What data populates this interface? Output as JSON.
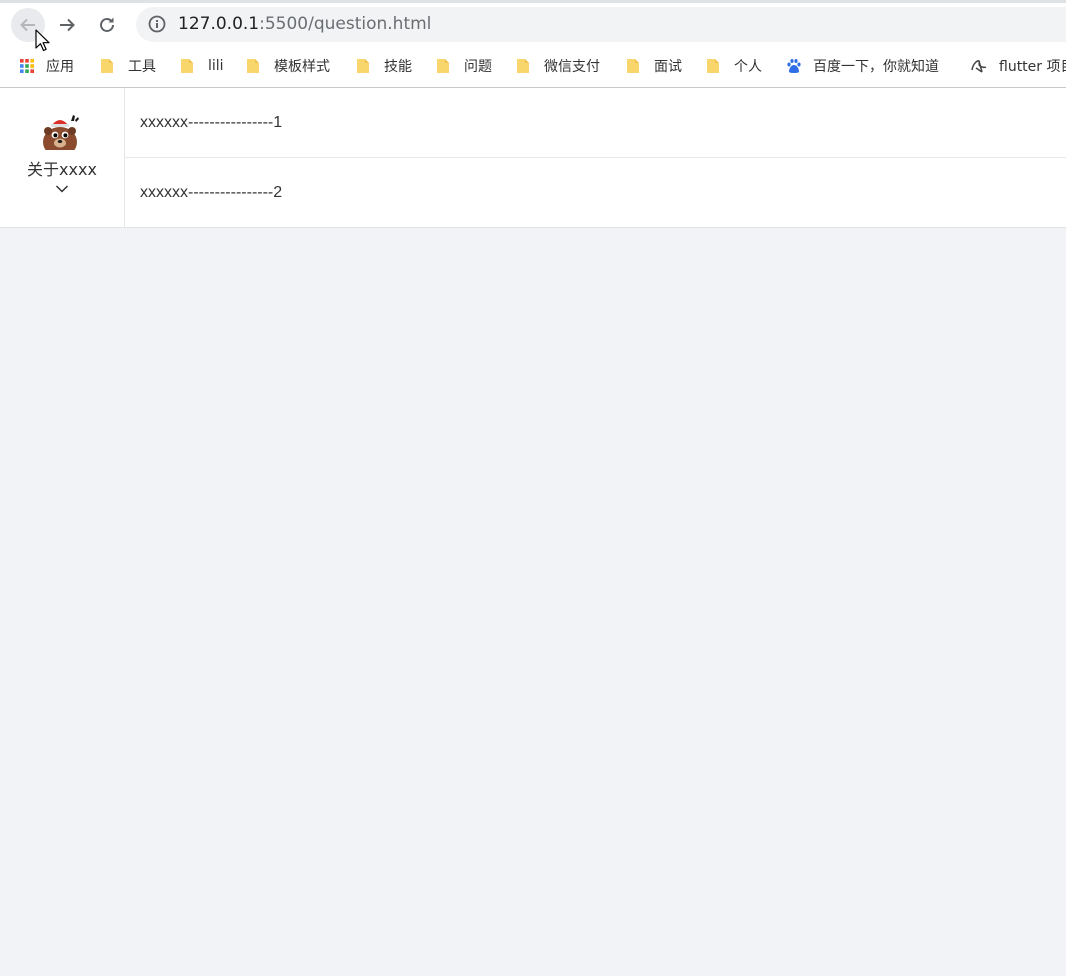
{
  "browser": {
    "url_host": "127.0.0.1",
    "url_rest": ":5500/question.html",
    "bookmarks": [
      {
        "label": "应用",
        "icon": "apps-grid-icon"
      },
      {
        "label": "工具",
        "icon": "folder-icon"
      },
      {
        "label": "lili",
        "icon": "folder-icon"
      },
      {
        "label": "模板样式",
        "icon": "folder-icon"
      },
      {
        "label": "技能",
        "icon": "folder-icon"
      },
      {
        "label": "问题",
        "icon": "folder-icon"
      },
      {
        "label": "微信支付",
        "icon": "folder-icon"
      },
      {
        "label": "面试",
        "icon": "folder-icon"
      },
      {
        "label": "个人",
        "icon": "folder-icon"
      },
      {
        "label": "百度一下，你就知道",
        "icon": "baidu-paw-icon"
      },
      {
        "label": "flutter 项目",
        "icon": "flutter-logo-icon"
      }
    ]
  },
  "page": {
    "menu": {
      "label": "关于xxxx",
      "avatar": "bear-avatar-icon",
      "chevron": "chevron-down-icon"
    },
    "items": [
      {
        "text": "xxxxxx----------------1"
      },
      {
        "text": "xxxxxx----------------2"
      }
    ]
  },
  "colors": {
    "page_bg": "#f2f3f7",
    "panel_bg": "#ffffff",
    "folder": "#f9d66b",
    "text": "#333333"
  }
}
